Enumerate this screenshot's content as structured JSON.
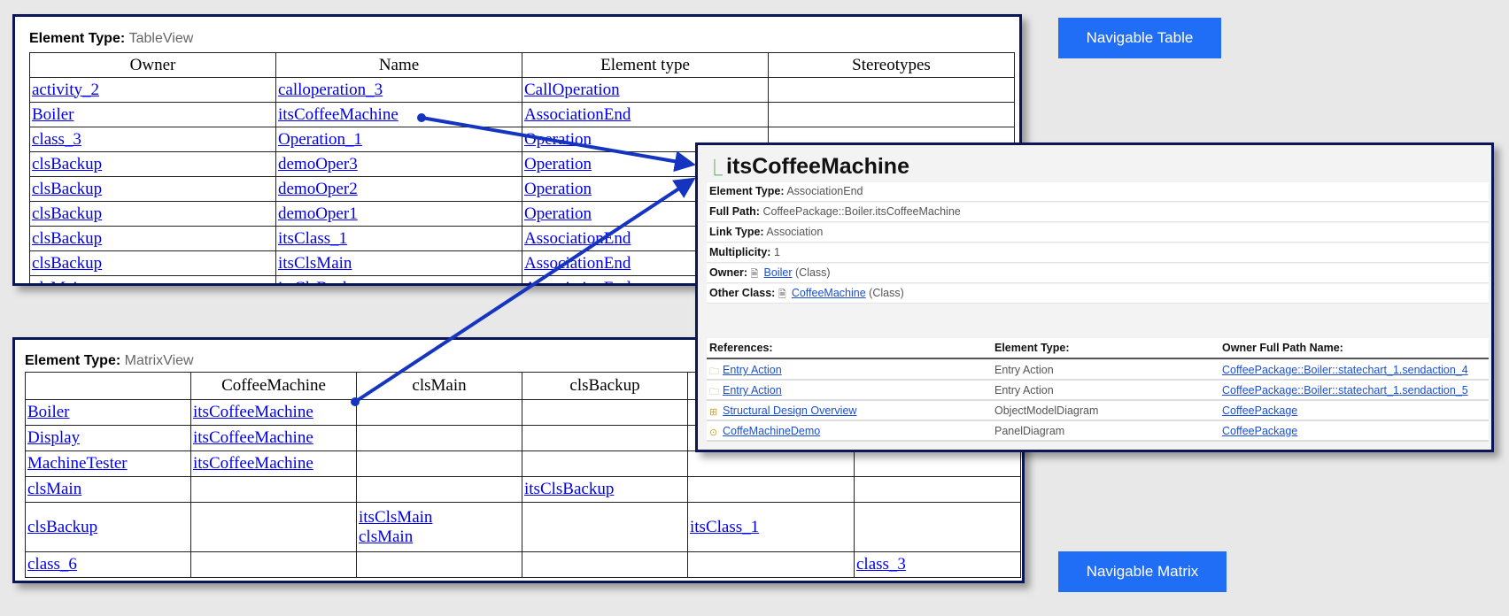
{
  "table_view": {
    "element_type_label": "Element Type:",
    "element_type_value": "TableView",
    "columns": [
      "Owner",
      "Name",
      "Element type",
      "Stereotypes"
    ],
    "rows": [
      [
        "activity_2",
        "calloperation_3",
        "CallOperation",
        ""
      ],
      [
        "Boiler",
        "itsCoffeeMachine",
        "AssociationEnd",
        ""
      ],
      [
        "class_3",
        "Operation_1",
        "Operation",
        ""
      ],
      [
        "clsBackup",
        "demoOper3",
        "Operation",
        ""
      ],
      [
        "clsBackup",
        "demoOper2",
        "Operation",
        ""
      ],
      [
        "clsBackup",
        "demoOper1",
        "Operation",
        ""
      ],
      [
        "clsBackup",
        "itsClass_1",
        "AssociationEnd",
        ""
      ],
      [
        "clsBackup",
        "itsClsMain",
        "AssociationEnd",
        ""
      ],
      [
        "clsMain",
        "itsClsBackup",
        "AssociationEnd",
        ""
      ]
    ]
  },
  "matrix_view": {
    "element_type_label": "Element Type:",
    "element_type_value": "MatrixView",
    "columns": [
      "",
      "CoffeeMachine",
      "clsMain",
      "clsBackup",
      "",
      ""
    ],
    "rows": [
      [
        "Boiler",
        "itsCoffeeMachine",
        "",
        "",
        "",
        ""
      ],
      [
        "Display",
        "itsCoffeeMachine",
        "",
        "",
        "",
        ""
      ],
      [
        "MachineTester",
        "itsCoffeeMachine",
        "",
        "",
        "",
        ""
      ],
      [
        "clsMain",
        "",
        "",
        "itsClsBackup",
        "",
        ""
      ],
      [
        "clsBackup",
        "",
        "itsClsMain\nclsMain",
        "",
        "itsClass_1",
        ""
      ],
      [
        "class_6",
        "",
        "",
        "",
        "",
        "class_3"
      ]
    ]
  },
  "buttons": {
    "navigable_table": "Navigable Table",
    "navigable_matrix": "Navigable Matrix"
  },
  "popup": {
    "title": "itsCoffeeMachine",
    "title_icon": "association-end-icon",
    "props": [
      {
        "label": "Element Type:",
        "value": "AssociationEnd"
      },
      {
        "label": "Full Path:",
        "value": "CoffeePackage::Boiler.itsCoffeeMachine"
      },
      {
        "label": "Link Type:",
        "value": "Association"
      },
      {
        "label": "Multiplicity:",
        "value": "1"
      },
      {
        "label": "Owner:",
        "link": "Boiler",
        "suffix": "(Class)",
        "icon": "class-icon"
      },
      {
        "label": "Other Class:",
        "link": "CoffeeMachine",
        "suffix": "(Class)",
        "icon": "class-icon"
      }
    ],
    "references_headers": [
      "References:",
      "Element Type:",
      "Owner Full Path Name:"
    ],
    "references": [
      {
        "icon": "folder-icon",
        "name": "Entry Action",
        "type": "Entry Action",
        "owner": "CoffeePackage::Boiler::statechart_1.sendaction_4"
      },
      {
        "icon": "folder-icon",
        "name": "Entry Action",
        "type": "Entry Action",
        "owner": "CoffeePackage::Boiler::statechart_1.sendaction_5"
      },
      {
        "icon": "object-model-diagram-icon",
        "name": "Structural Design Overview",
        "type": "ObjectModelDiagram",
        "owner": "CoffeePackage"
      },
      {
        "icon": "panel-diagram-icon",
        "name": "CoffeMachineDemo",
        "type": "PanelDiagram",
        "owner": "CoffeePackage"
      }
    ]
  },
  "colors": {
    "accent": "#1f6ef5",
    "arrow": "#1535c0",
    "border": "#0c1656",
    "link": "#0000ee"
  }
}
